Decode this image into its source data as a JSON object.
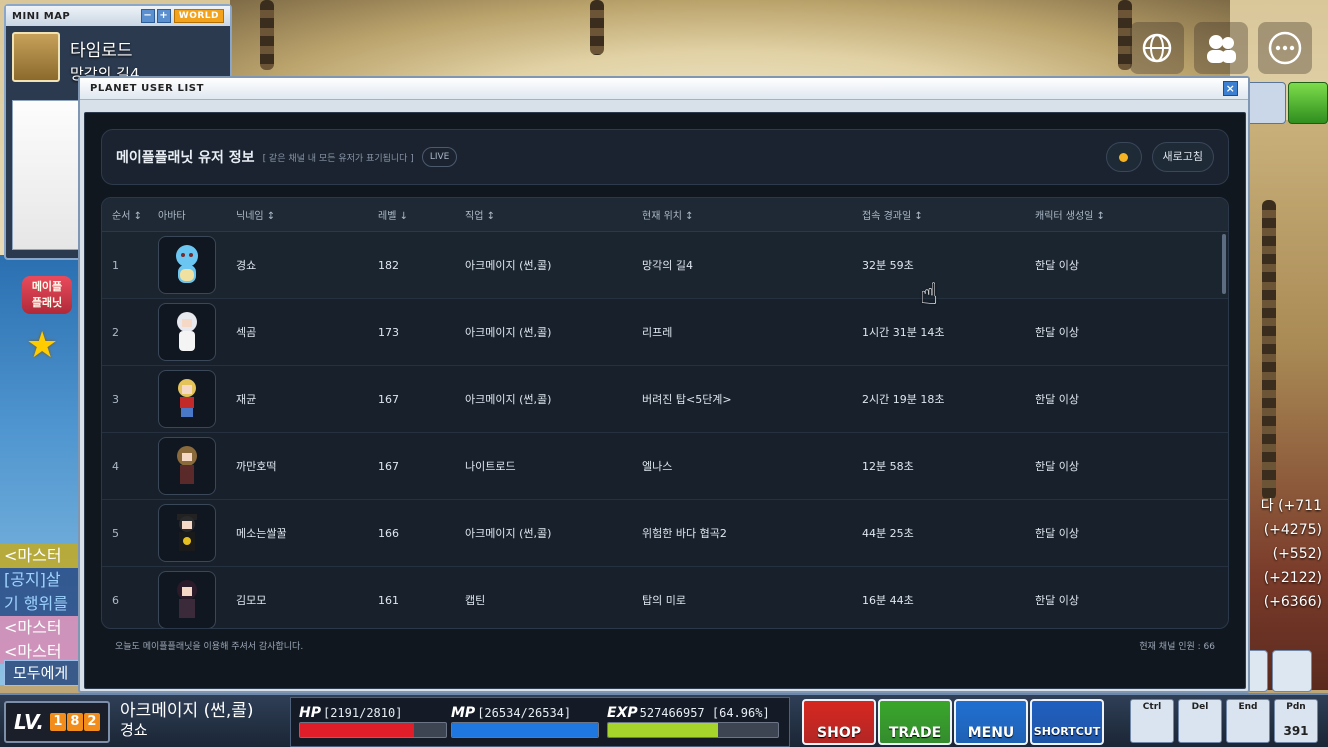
{
  "minimap": {
    "title": "MINI MAP",
    "btn_minus": "−",
    "btn_plus": "+",
    "world_label": "WORLD",
    "map_group": "타임로드",
    "map_name": "망각의 길4"
  },
  "side": {
    "badge_line1": "메이플",
    "badge_line2": "플래닛",
    "chat": [
      "<마스터",
      "[공지]살",
      "기 행위를",
      "<마스터",
      "<마스터"
    ],
    "chat_all": "모두에게",
    "right_texts": [
      "다 (+711",
      "(+4275)",
      "(+552)",
      "(+2122)",
      "(+6366)"
    ]
  },
  "dialog": {
    "titlebar": "PLANET USER LIST",
    "close": "×",
    "header": {
      "title": "메이플플래닛 유저 정보",
      "subtitle": "[ 같은 채널 내 모든 유저가 표기됩니다 ]",
      "live": "LIVE",
      "refresh": "새로고침"
    },
    "columns": {
      "no": "순서 ↕",
      "avatar": "아바타",
      "nick": "닉네임 ↕",
      "level": "레벨 ↓",
      "job": "직업 ↕",
      "location": "현재 위치 ↕",
      "elapsed": "접속 경과일 ↕",
      "created": "캐릭터 생성일 ↕"
    },
    "rows": [
      {
        "no": "1",
        "nick": "경쇼",
        "level": "182",
        "job": "아크메이지 (썬,콜)",
        "location": "망각의 길4",
        "elapsed": "32분 59초",
        "created": "한달 이상"
      },
      {
        "no": "2",
        "nick": "섹곰",
        "level": "173",
        "job": "아크메이지 (썬,콜)",
        "location": "리프레",
        "elapsed": "1시간 31분 14초",
        "created": "한달 이상"
      },
      {
        "no": "3",
        "nick": "재균",
        "level": "167",
        "job": "아크메이지 (썬,콜)",
        "location": "버려진 탑<5단계>",
        "elapsed": "2시간 19분 18초",
        "created": "한달 이상"
      },
      {
        "no": "4",
        "nick": "까만호떡",
        "level": "167",
        "job": "나이트로드",
        "location": "엘나스",
        "elapsed": "12분 58초",
        "created": "한달 이상"
      },
      {
        "no": "5",
        "nick": "메소는쌀꿀",
        "level": "166",
        "job": "아크메이지 (썬,콜)",
        "location": "위험한 바다 협곡2",
        "elapsed": "44분 25초",
        "created": "한달 이상"
      },
      {
        "no": "6",
        "nick": "김모모",
        "level": "161",
        "job": "캡틴",
        "location": "탑의 미로",
        "elapsed": "16분 44초",
        "created": "한달 이상"
      }
    ],
    "footer_left": "오늘도 메이플플래닛을 이용해 주셔서 감사합니다.",
    "footer_right": "현재 채널 인원 : 66"
  },
  "status": {
    "lv_label": "LV.",
    "level_digits": [
      "1",
      "8",
      "2"
    ],
    "job": "아크메이지 (썬,콜)",
    "name": "경쇼",
    "hp_label": "HP",
    "hp_value": "[2191/2810]",
    "hp_fraction": 0.78,
    "mp_label": "MP",
    "mp_value": "[26534/26534]",
    "mp_fraction": 1.0,
    "exp_label": "EXP",
    "exp_value": "527466957 [64.96%]",
    "exp_fraction": 0.6496,
    "buttons": [
      "SHOP",
      "TRADE",
      "MENU",
      "SHORTCUT"
    ],
    "quick_keys": [
      "Ctrl",
      "Del",
      "End",
      "Pdn"
    ],
    "quick_count": "391"
  },
  "colors": {
    "hp": "#e01e2a",
    "mp": "#1f78e0",
    "exp": "#a6d42a",
    "shop": "#d7261f",
    "trade": "#39a52a",
    "menu": "#1f6fd1",
    "shortcut": "#1f5fc0"
  }
}
